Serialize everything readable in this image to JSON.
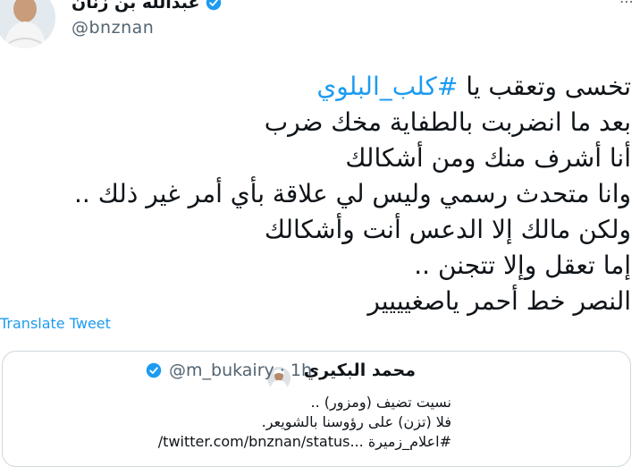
{
  "author": {
    "name": "عبدالله بن زنان",
    "handle": "@bnznan"
  },
  "tweet": {
    "lines": [
      "تخسى وتعقب يا",
      "بعد ما انضربت بالطفاية مخك ضرب",
      "أنا أشرف منك ومن أشكالك",
      "وانا متحدث رسمي وليس لي علاقة بأي أمر غير ذلك ..",
      "ولكن مالك إلا الدعس أنت وأشكالك",
      "إما تعقل وإلا تتجنن ..",
      "النصر خط أحمر ياصغيييير"
    ],
    "hashtag": "#كلب_البلوي"
  },
  "translate_label": "Translate Tweet",
  "more_icon": "⋯",
  "quoted": {
    "name": "محمد البكيري",
    "handle_time": "@m_bukairy · 1h",
    "lines": [
      "نسيت تضيف (ومزور) ..",
      "فلا (تزن) على رؤوسنا بالشويعر.",
      "#اعلام_زميرة ...twitter.com/bnznan/status/"
    ]
  },
  "colors": {
    "accent": "#1d9bf0",
    "muted": "#536471",
    "border": "#cfd9de"
  }
}
